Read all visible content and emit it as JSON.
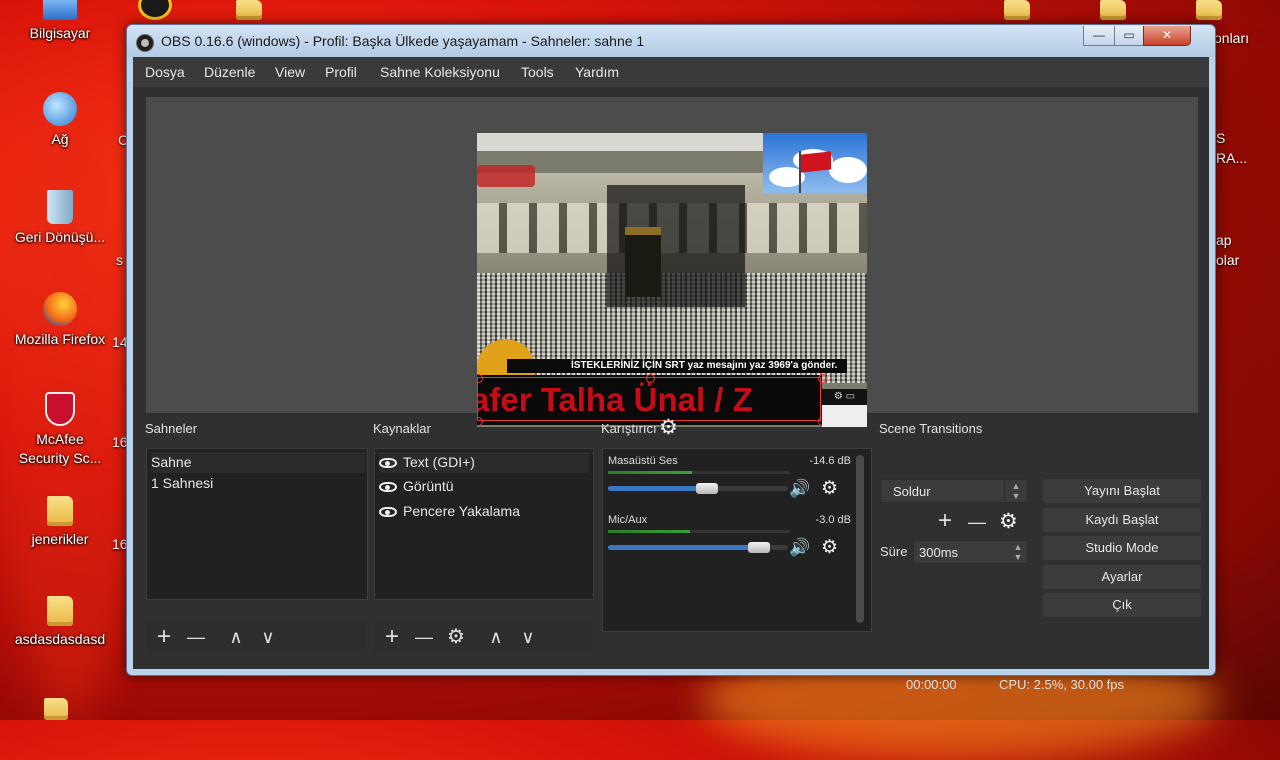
{
  "desktop": {
    "icons": [
      {
        "label": "Bilgisayar"
      },
      {
        "label": "Ağ"
      },
      {
        "label": "Geri Dönüşü..."
      },
      {
        "label": "Mozilla Firefox"
      },
      {
        "label": "McAfee Security Sc..."
      },
      {
        "label": "jenerikler"
      },
      {
        "label": "asdasdasdasd"
      }
    ],
    "right_fragments": [
      "onları",
      "S",
      "RA...",
      "ap",
      "olar"
    ],
    "left_fragments": [
      "C",
      "s",
      "14",
      "16",
      "16"
    ]
  },
  "window": {
    "title": "OBS 0.16.6 (windows) - Profil: Başka Ülkede yaşayamam - Sahneler: sahne 1",
    "controls": {
      "minimize": "—",
      "maximize": "▭",
      "close": "✕"
    }
  },
  "menu": [
    "Dosya",
    "Düzenle",
    "View",
    "Profil",
    "Sahne Koleksiyonu",
    "Tools",
    "Yardım"
  ],
  "preview": {
    "ticker_text": "İSTEKLERİNİZ İÇİN SRT yaz mesajını yaz 3969'a gönder.",
    "scroll_text": "afer Talha Ünal  /  Z"
  },
  "scenes": {
    "label": "Sahneler",
    "items": [
      "Sahne",
      "1 Sahnesi"
    ]
  },
  "sources": {
    "label": "Kaynaklar",
    "items": [
      "Text (GDI+)",
      "Görüntü",
      "Pencere Yakalama"
    ]
  },
  "mixer": {
    "label": "Karıştırıcı",
    "channels": [
      {
        "name": "Masaüstü Ses",
        "db": "-14.6 dB",
        "level": 0.46,
        "volume": 0.55
      },
      {
        "name": "Mic/Aux",
        "db": "-3.0 dB",
        "level": 0.45,
        "volume": 0.84
      }
    ]
  },
  "transitions": {
    "label": "Scene Transitions",
    "selected": "Soldur",
    "duration_label": "Süre",
    "duration_value": "300ms"
  },
  "controls": {
    "start_stream": "Yayını Başlat",
    "start_record": "Kaydı Başlat",
    "studio_mode": "Studio Mode",
    "settings": "Ayarlar",
    "exit": "Çık"
  },
  "statusbar": {
    "time": "00:00:00",
    "cpu": "CPU: 2.5%, 30.00 fps"
  },
  "icons": {
    "add": "+",
    "remove": "—",
    "up": "∧",
    "down": "∨",
    "gear": "⚙",
    "speaker": "🔊"
  },
  "colors": {
    "obs_bg": "#303030",
    "panel_bg": "#212121",
    "fader_blue": "#3a78c4",
    "meter_green": "#38a238",
    "desktop_red": "#d81409",
    "scroll_text_red": "#c60c16"
  }
}
